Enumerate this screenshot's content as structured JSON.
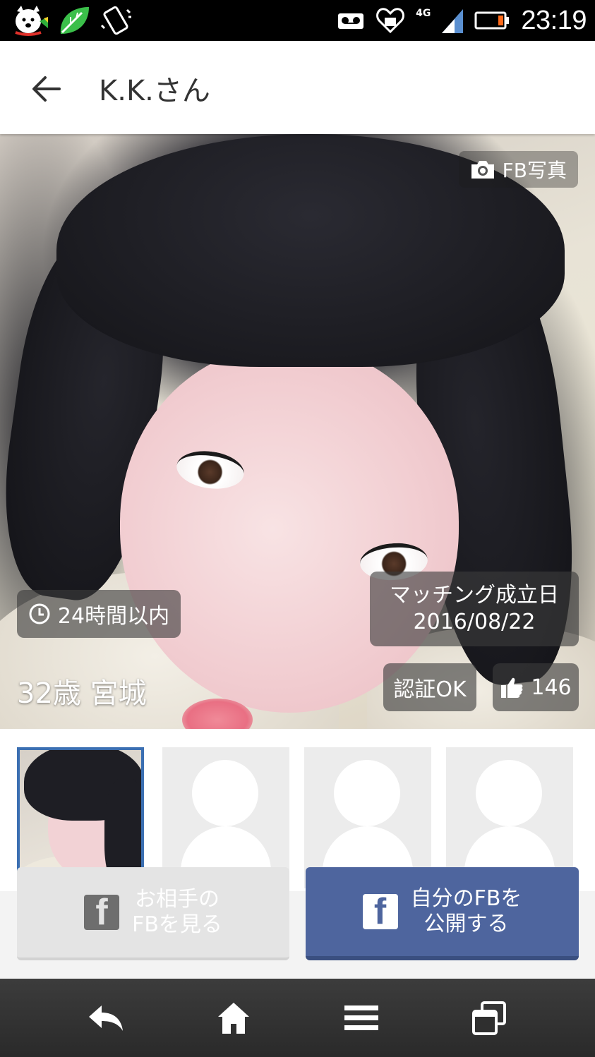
{
  "status_bar": {
    "time": "23:19",
    "network": "4G",
    "icons": [
      "dog-mascot-icon",
      "leaf-icon",
      "phone-vibrate-icon",
      "voicemail-icon",
      "heart-icon",
      "signal-icon",
      "battery-icon"
    ]
  },
  "app_bar": {
    "title": "K.K.さん",
    "back_icon": "arrow-left-icon"
  },
  "profile": {
    "fb_photo_label": "FB写真",
    "login_status": "24時間以内",
    "match_label": "マッチング成立日",
    "match_date": "2016/08/22",
    "age_location": "32歳 宮城",
    "verified_label": "認証OK",
    "likes": "146"
  },
  "thumbnails": [
    {
      "type": "photo",
      "selected": true
    },
    {
      "type": "placeholder",
      "selected": false
    },
    {
      "type": "placeholder",
      "selected": false
    },
    {
      "type": "placeholder",
      "selected": false
    }
  ],
  "actions": {
    "view_partner_fb_line1": "お相手の",
    "view_partner_fb_line2": "FBを見る",
    "publish_my_fb_line1": "自分のFBを",
    "publish_my_fb_line2": "公開する",
    "fb_logo": "f"
  },
  "colors": {
    "facebook_blue": "#4e659e",
    "selected_thumb_border": "#3b6fb2",
    "disabled_button": "#e4e4e4"
  },
  "nav_bar": [
    "back-icon",
    "home-icon",
    "menu-icon",
    "recent-apps-icon"
  ]
}
